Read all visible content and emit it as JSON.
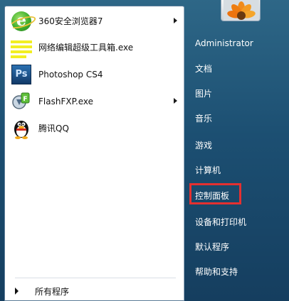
{
  "start_menu": {
    "pinned_programs": [
      {
        "label": "360安全浏览器7",
        "icon": "360-browser-icon",
        "has_submenu": true
      },
      {
        "label": "网络编辑超级工具箱.exe",
        "icon": "toolbox-icon",
        "has_submenu": false
      },
      {
        "label": "Photoshop CS4",
        "icon": "photoshop-icon",
        "icon_text": "Ps",
        "has_submenu": false
      },
      {
        "label": "FlashFXP.exe",
        "icon": "flashfxp-icon",
        "has_submenu": true
      },
      {
        "label": "腾讯QQ",
        "icon": "qq-penguin-icon",
        "has_submenu": false
      }
    ],
    "all_programs_label": "所有程序",
    "user_name": "Administrator",
    "right_items": [
      {
        "label": "文档"
      },
      {
        "label": "图片"
      },
      {
        "label": "音乐"
      },
      {
        "label": "游戏"
      },
      {
        "label": "计算机"
      },
      {
        "label": "控制面板",
        "highlighted": true
      },
      {
        "label": "设备和打印机"
      },
      {
        "label": "默认程序"
      },
      {
        "label": "帮助和支持"
      }
    ],
    "colors": {
      "highlight": "#e53030",
      "right_pane": "#1c4f72",
      "left_pane": "#ffffff"
    }
  }
}
